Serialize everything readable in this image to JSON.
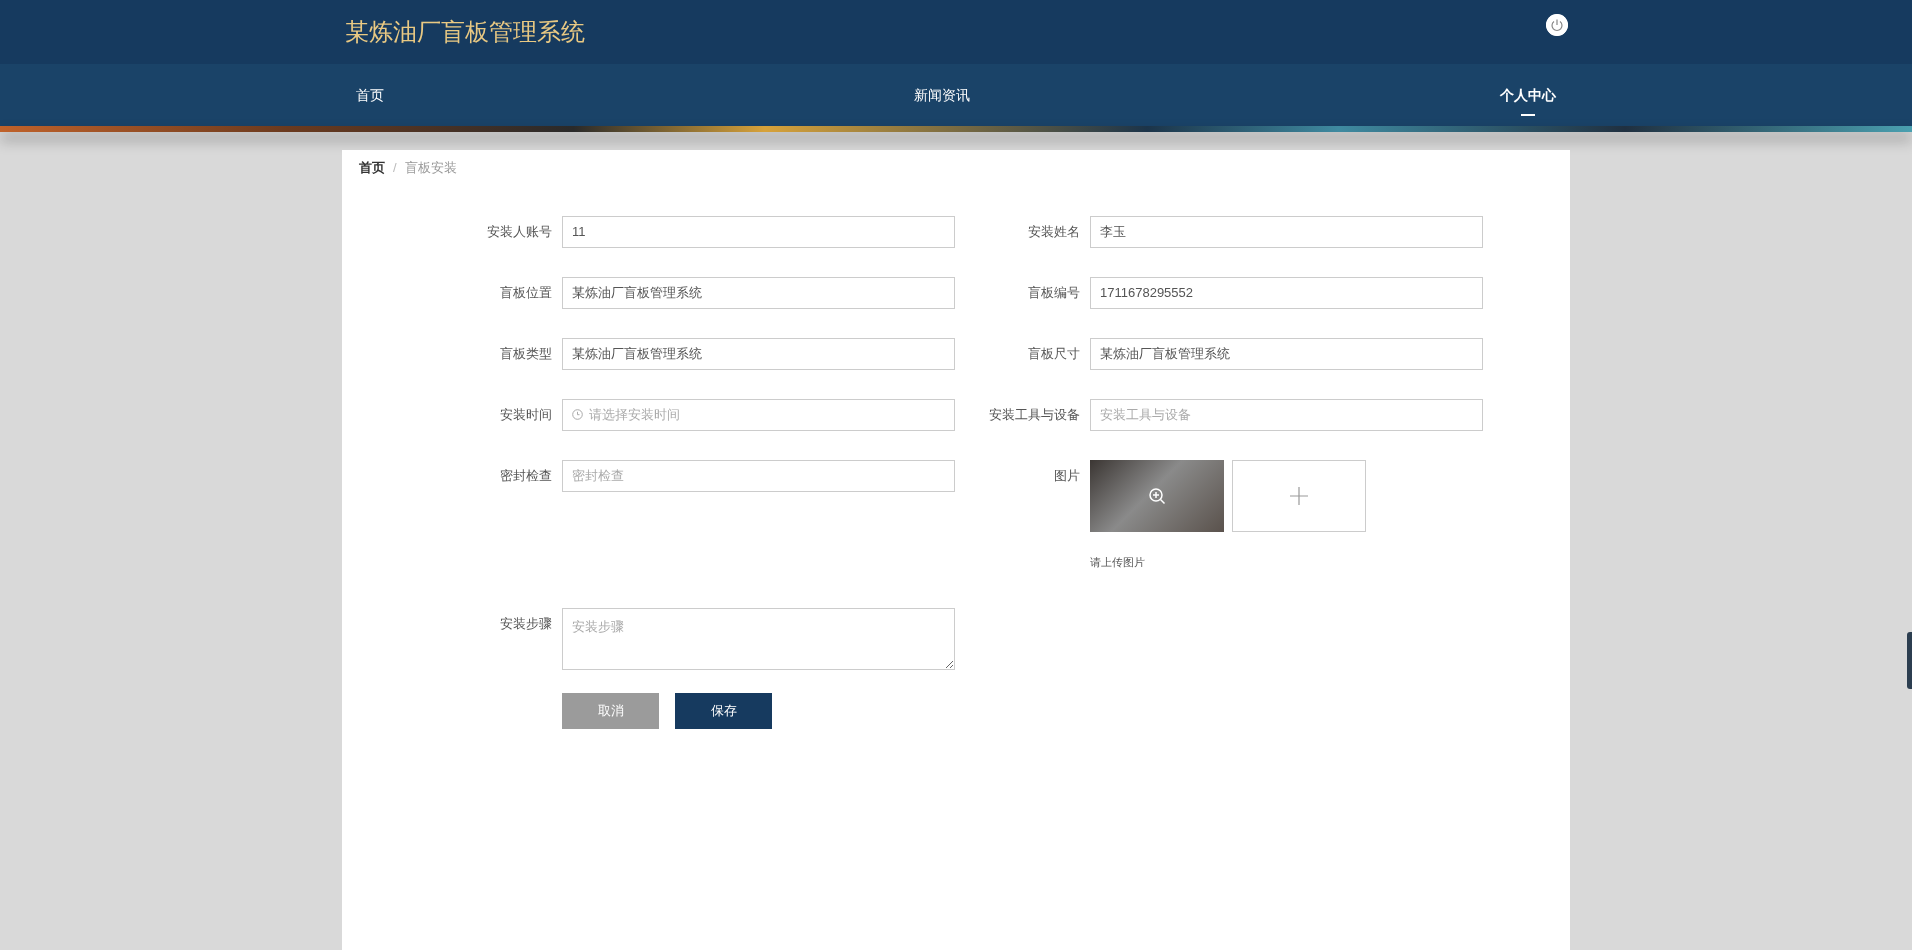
{
  "header": {
    "title": "某炼油厂盲板管理系统"
  },
  "nav": [
    {
      "label": "首页",
      "selected": false
    },
    {
      "label": "新闻资讯",
      "selected": false
    },
    {
      "label": "个人中心",
      "selected": true
    }
  ],
  "breadcrumb_separator": "/",
  "breadcrumb": [
    {
      "label": "首页",
      "selected": false
    },
    {
      "label": "盲板安装",
      "selected": true
    }
  ],
  "form": {
    "fields": [
      {
        "kind": "text",
        "label": "安装人账号",
        "value": "11"
      },
      {
        "kind": "text",
        "label": "安装姓名",
        "value": "李玉"
      },
      {
        "kind": "text",
        "label": "盲板位置",
        "value": "某炼油厂盲板管理系统"
      },
      {
        "kind": "text",
        "label": "盲板编号",
        "value": "1711678295552"
      },
      {
        "kind": "text",
        "label": "盲板类型",
        "value": "某炼油厂盲板管理系统"
      },
      {
        "kind": "text",
        "label": "盲板尺寸",
        "value": "某炼油厂盲板管理系统"
      },
      {
        "kind": "date",
        "label": "安装时间",
        "placeholder": "请选择安装时间"
      },
      {
        "kind": "text",
        "label": "安装工具与设备",
        "placeholder": "安装工具与设备"
      },
      {
        "kind": "text",
        "label": "密封检查",
        "placeholder": "密封检查"
      },
      {
        "kind": "upload",
        "label": "图片",
        "hint": "请上传图片"
      },
      {
        "kind": "textarea",
        "label": "安装步骤",
        "placeholder": "安装步骤"
      }
    ],
    "buttons": [
      {
        "kind": "cancel",
        "label": "取消"
      },
      {
        "kind": "save",
        "label": "保存"
      }
    ]
  }
}
